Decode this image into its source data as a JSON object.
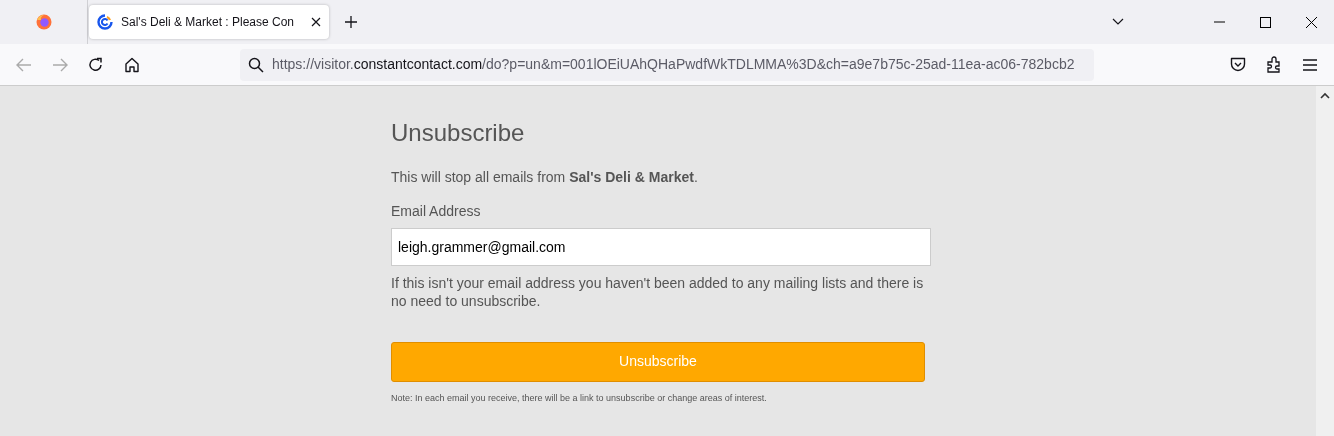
{
  "browser": {
    "tab": {
      "title": "Sal's Deli & Market : Please Con",
      "selected": true
    },
    "address": {
      "prefix": "https://visitor.",
      "domain": "constantcontact.com",
      "rest": "/do?p=un&m=001lOEiUAhQHaPwdfWkTDLMMA%3D&ch=a9e7b75c-25ad-11ea-ac06-782bcb2"
    }
  },
  "page": {
    "title": "Unsubscribe",
    "intro": "This will stop all emails from **Sal's Deli & Market**.",
    "email_label": "Email Address",
    "email_value": "leigh.grammer@gmail.com",
    "help": "If this isn't your email address you haven't been added to any mailing lists and there is no need to unsubscribe.",
    "button": "Unsubscribe",
    "note": "Note: In each email you receive, there will be a link to unsubscribe or change areas of interest."
  }
}
